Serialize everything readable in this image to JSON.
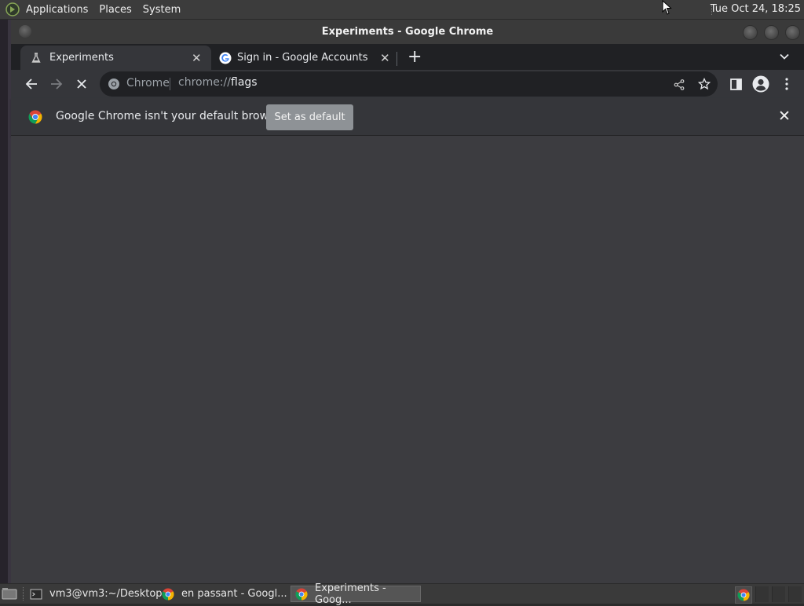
{
  "top_panel": {
    "menus": [
      "Applications",
      "Places",
      "System"
    ],
    "clock": "Tue Oct 24, 18:25"
  },
  "window": {
    "title": "Experiments - Google Chrome"
  },
  "tabs": [
    {
      "title": "Experiments",
      "active": true,
      "icon": "flask-icon"
    },
    {
      "title": "Sign in - Google Accounts",
      "active": false,
      "icon": "google-g-icon"
    }
  ],
  "toolbar": {
    "chip": "Chrome",
    "url_scheme": "chrome://",
    "url_host": "flags",
    "icons": [
      "back-arrow-icon",
      "forward-arrow-icon",
      "stop-icon",
      "share-icon",
      "bookmark-star-icon",
      "side-panel-icon",
      "profile-icon",
      "more-menu-icon"
    ]
  },
  "infobar": {
    "message": "Google Chrome isn't your default browser",
    "button": "Set as default"
  },
  "taskbar": {
    "items": [
      {
        "label": "vm3@vm3:~/Desktop",
        "icon": "terminal-icon",
        "active": false
      },
      {
        "label": "en passant - Googl...",
        "icon": "chrome-icon",
        "active": false
      },
      {
        "label": "Experiments - Goog...",
        "icon": "chrome-icon",
        "active": true
      }
    ]
  },
  "colors": {
    "content_bg": "#3c3c40",
    "toolbar_bg": "#35363a",
    "tabstrip_bg": "#202124",
    "button_bg": "#8e9296"
  }
}
